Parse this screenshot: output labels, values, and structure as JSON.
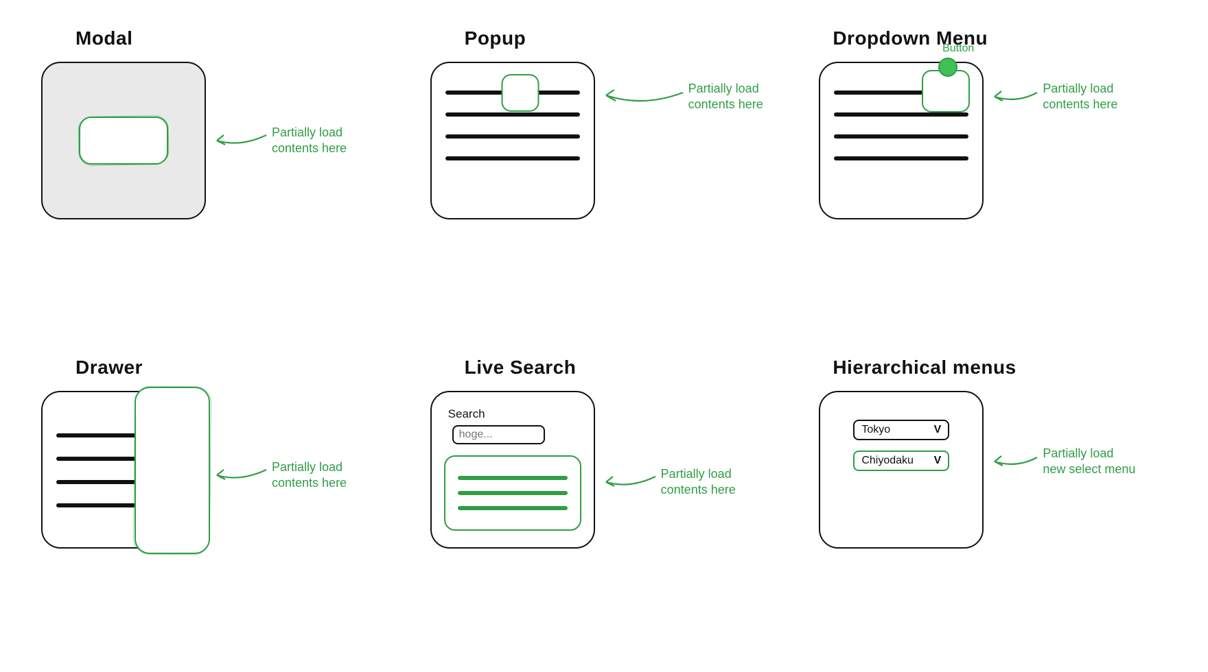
{
  "patterns": {
    "modal": {
      "title": "Modal",
      "annotation": "Partially load\ncontents here"
    },
    "popup": {
      "title": "Popup",
      "annotation": "Partially load\ncontents here"
    },
    "dropdown": {
      "title": "Dropdown Menu",
      "button_label": "Button",
      "annotation": "Partially load\ncontents here"
    },
    "drawer": {
      "title": "Drawer",
      "annotation": "Partially load\ncontents here"
    },
    "live_search": {
      "title": "Live Search",
      "search_label": "Search",
      "search_placeholder": "hoge...",
      "annotation": "Partially load\ncontents here"
    },
    "hierarchical": {
      "title": "Hierarchical menus",
      "select1_value": "Tokyo",
      "select2_value": "Chiyodaku",
      "chevron": "V",
      "annotation": "Partially load\nnew select menu"
    }
  },
  "colors": {
    "accent": "#2f9e44",
    "ink": "#111111",
    "panel_bg": "#ffffff",
    "shade": "#e9e9e9"
  }
}
